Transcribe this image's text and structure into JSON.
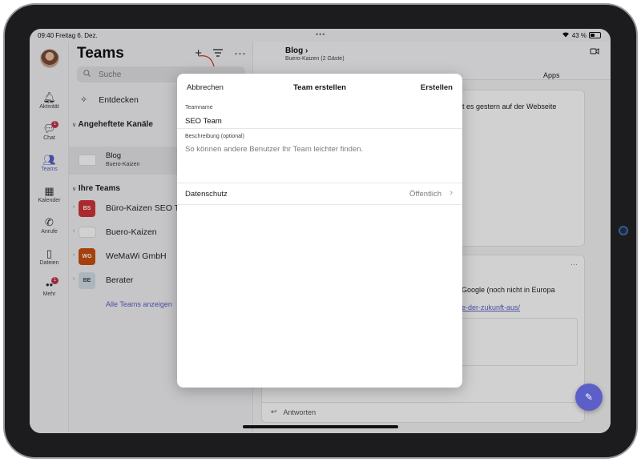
{
  "status_bar": {
    "time_date": "09:40  Freitag 6. Dez.",
    "dots": "•••",
    "battery_text": "43 %",
    "battery_level": 0.43
  },
  "rail": {
    "items": [
      {
        "label": "Aktivität",
        "icon": "bell-icon",
        "glyph": "🔔︎"
      },
      {
        "label": "Chat",
        "icon": "chat-icon",
        "glyph": "💬︎",
        "badge": "1"
      },
      {
        "label": "Teams",
        "icon": "teams-icon",
        "glyph": "👥︎",
        "active": true
      },
      {
        "label": "Kalender",
        "icon": "calendar-icon",
        "glyph": "▦"
      },
      {
        "label": "Anrufe",
        "icon": "phone-icon",
        "glyph": "✆"
      },
      {
        "label": "Dateien",
        "icon": "file-icon",
        "glyph": "▯"
      },
      {
        "label": "Mehr",
        "icon": "more-icon",
        "glyph": "••",
        "badge": "1"
      }
    ]
  },
  "panel": {
    "title": "Teams",
    "search_placeholder": "Suche",
    "discover_label": "Entdecken",
    "pinned_section": "Angeheftete Kanäle",
    "pinned": {
      "name": "Blog",
      "sub": "Buero-Kaizen"
    },
    "teams_section": "Ihre Teams",
    "teams": [
      {
        "initials": "BS",
        "name": "Büro-Kaizen SEO T",
        "color": "#d13438"
      },
      {
        "initials": "",
        "name": "Buero-Kaizen",
        "color": "#ffffff"
      },
      {
        "initials": "WG",
        "name": "WeMaWi GmbH",
        "color": "#ca5010"
      },
      {
        "initials": "BE",
        "name": "Berater",
        "color": "#d3dee6"
      }
    ],
    "all_teams": "Alle Teams anzeigen"
  },
  "main": {
    "title": "Blog ›",
    "subtitle": "Buero-Kaizen (2 Gäste)",
    "tab_apps": "Apps",
    "card1_text": "at es gestern auf der Webseite",
    "card2_more": "···",
    "card2_text": "Google (noch nicht in Europa",
    "card2_link": "e-der-zukunft-aus/",
    "reply_label": "Antworten"
  },
  "modal": {
    "cancel": "Abbrechen",
    "title": "Team erstellen",
    "create": "Erstellen",
    "name_label": "Teamname",
    "name_value": "SEO Team",
    "desc_label": "Beschreibung (optional)",
    "desc_placeholder": "So können andere Benutzer Ihr Team leichter finden.",
    "privacy_label": "Datenschutz",
    "privacy_value": "Öffentlich"
  },
  "colors": {
    "accent": "#5b5fc7",
    "badge": "#c4314b"
  }
}
